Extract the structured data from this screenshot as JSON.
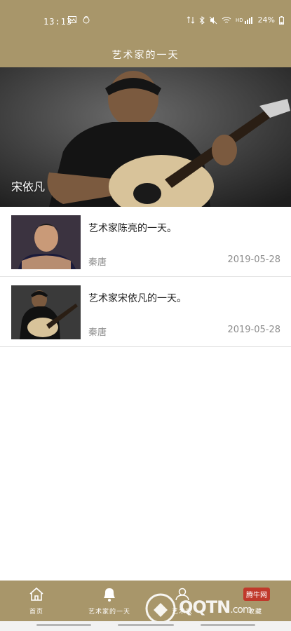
{
  "status_bar": {
    "time": "13:13",
    "battery_percent": "24%",
    "left_icons": [
      "image-icon",
      "notification-icon"
    ],
    "right_icons": [
      "data-icon",
      "bluetooth-icon",
      "mute-icon",
      "wifi-icon",
      "hd-signal-icon",
      "battery-icon"
    ]
  },
  "header": {
    "title": "艺术家的一天"
  },
  "banner": {
    "caption": "宋依凡"
  },
  "articles": [
    {
      "title": "艺术家陈亮的一天。",
      "author": "秦唐",
      "date": "2019-05-28"
    },
    {
      "title": "艺术家宋依凡的一天。",
      "author": "秦唐",
      "date": "2019-05-28"
    }
  ],
  "tab_bar": {
    "tabs": [
      {
        "label": "首页",
        "icon": "home-icon"
      },
      {
        "label": "艺术家的一天",
        "icon": "bell-icon"
      },
      {
        "label": "艺术家",
        "icon": "user-icon"
      },
      {
        "label": "收藏",
        "icon": "heart-icon"
      }
    ]
  },
  "watermark": {
    "text": "QQTN",
    "suffix": ".com",
    "tag": "腾牛网"
  },
  "colors": {
    "brand": "#a8966a",
    "text_muted": "#8d8d8d",
    "divider": "#e2e2e2"
  }
}
